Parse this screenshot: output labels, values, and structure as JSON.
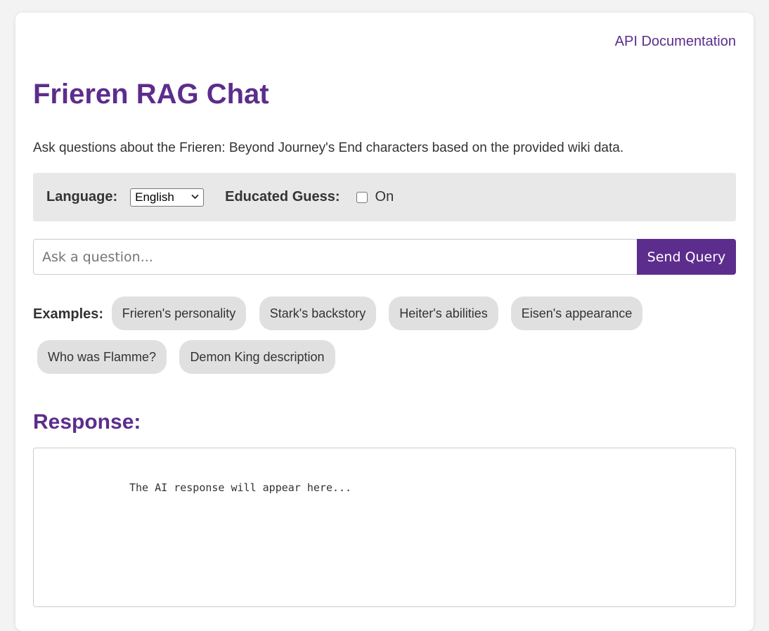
{
  "header": {
    "api_link": "API Documentation",
    "title": "Frieren RAG Chat",
    "subtitle": "Ask questions about the Frieren: Beyond Journey's End characters based on the provided wiki data."
  },
  "options": {
    "language_label": "Language:",
    "language_value": "English",
    "educated_guess_label": "Educated Guess:",
    "educated_guess_checked": false,
    "on_label": "On"
  },
  "query": {
    "placeholder": "Ask a question...",
    "send_label": "Send Query"
  },
  "examples": {
    "label": "Examples:",
    "chips": [
      "Frieren's personality",
      "Stark's backstory",
      "Heiter's abilities",
      "Eisen's appearance",
      "Who was Flamme?",
      "Demon King description"
    ]
  },
  "response": {
    "title": "Response:",
    "placeholder_text": "The AI response will appear here..."
  },
  "colors": {
    "accent": "#5c2d8c",
    "chip_bg": "#e0e0e0",
    "options_bg": "#e8e8e8"
  }
}
